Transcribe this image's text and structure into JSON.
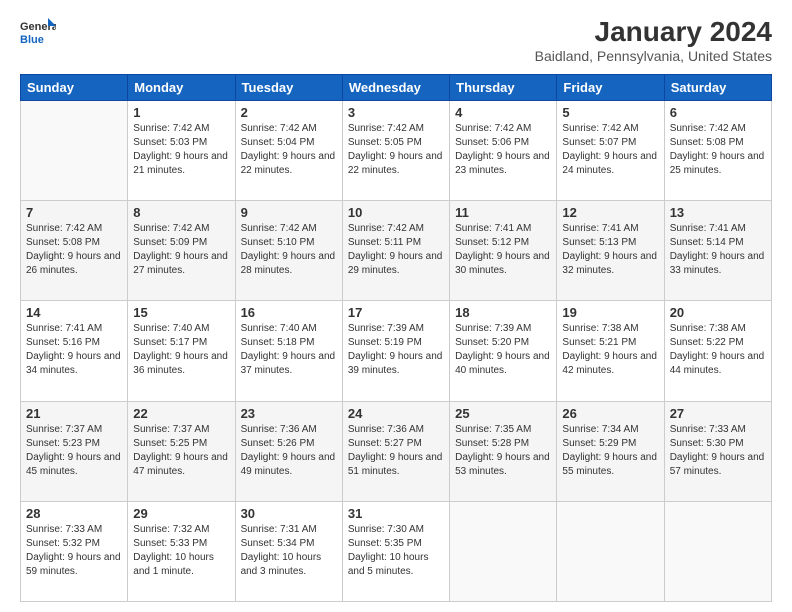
{
  "logo": {
    "general": "General",
    "blue": "Blue"
  },
  "title": {
    "month_year": "January 2024",
    "location": "Baidland, Pennsylvania, United States"
  },
  "days_header": [
    "Sunday",
    "Monday",
    "Tuesday",
    "Wednesday",
    "Thursday",
    "Friday",
    "Saturday"
  ],
  "weeks": [
    [
      {
        "day": "",
        "sunrise": "",
        "sunset": "",
        "daylight": ""
      },
      {
        "day": "1",
        "sunrise": "Sunrise: 7:42 AM",
        "sunset": "Sunset: 5:03 PM",
        "daylight": "Daylight: 9 hours and 21 minutes."
      },
      {
        "day": "2",
        "sunrise": "Sunrise: 7:42 AM",
        "sunset": "Sunset: 5:04 PM",
        "daylight": "Daylight: 9 hours and 22 minutes."
      },
      {
        "day": "3",
        "sunrise": "Sunrise: 7:42 AM",
        "sunset": "Sunset: 5:05 PM",
        "daylight": "Daylight: 9 hours and 22 minutes."
      },
      {
        "day": "4",
        "sunrise": "Sunrise: 7:42 AM",
        "sunset": "Sunset: 5:06 PM",
        "daylight": "Daylight: 9 hours and 23 minutes."
      },
      {
        "day": "5",
        "sunrise": "Sunrise: 7:42 AM",
        "sunset": "Sunset: 5:07 PM",
        "daylight": "Daylight: 9 hours and 24 minutes."
      },
      {
        "day": "6",
        "sunrise": "Sunrise: 7:42 AM",
        "sunset": "Sunset: 5:08 PM",
        "daylight": "Daylight: 9 hours and 25 minutes."
      }
    ],
    [
      {
        "day": "7",
        "sunrise": "Sunrise: 7:42 AM",
        "sunset": "Sunset: 5:08 PM",
        "daylight": "Daylight: 9 hours and 26 minutes."
      },
      {
        "day": "8",
        "sunrise": "Sunrise: 7:42 AM",
        "sunset": "Sunset: 5:09 PM",
        "daylight": "Daylight: 9 hours and 27 minutes."
      },
      {
        "day": "9",
        "sunrise": "Sunrise: 7:42 AM",
        "sunset": "Sunset: 5:10 PM",
        "daylight": "Daylight: 9 hours and 28 minutes."
      },
      {
        "day": "10",
        "sunrise": "Sunrise: 7:42 AM",
        "sunset": "Sunset: 5:11 PM",
        "daylight": "Daylight: 9 hours and 29 minutes."
      },
      {
        "day": "11",
        "sunrise": "Sunrise: 7:41 AM",
        "sunset": "Sunset: 5:12 PM",
        "daylight": "Daylight: 9 hours and 30 minutes."
      },
      {
        "day": "12",
        "sunrise": "Sunrise: 7:41 AM",
        "sunset": "Sunset: 5:13 PM",
        "daylight": "Daylight: 9 hours and 32 minutes."
      },
      {
        "day": "13",
        "sunrise": "Sunrise: 7:41 AM",
        "sunset": "Sunset: 5:14 PM",
        "daylight": "Daylight: 9 hours and 33 minutes."
      }
    ],
    [
      {
        "day": "14",
        "sunrise": "Sunrise: 7:41 AM",
        "sunset": "Sunset: 5:16 PM",
        "daylight": "Daylight: 9 hours and 34 minutes."
      },
      {
        "day": "15",
        "sunrise": "Sunrise: 7:40 AM",
        "sunset": "Sunset: 5:17 PM",
        "daylight": "Daylight: 9 hours and 36 minutes."
      },
      {
        "day": "16",
        "sunrise": "Sunrise: 7:40 AM",
        "sunset": "Sunset: 5:18 PM",
        "daylight": "Daylight: 9 hours and 37 minutes."
      },
      {
        "day": "17",
        "sunrise": "Sunrise: 7:39 AM",
        "sunset": "Sunset: 5:19 PM",
        "daylight": "Daylight: 9 hours and 39 minutes."
      },
      {
        "day": "18",
        "sunrise": "Sunrise: 7:39 AM",
        "sunset": "Sunset: 5:20 PM",
        "daylight": "Daylight: 9 hours and 40 minutes."
      },
      {
        "day": "19",
        "sunrise": "Sunrise: 7:38 AM",
        "sunset": "Sunset: 5:21 PM",
        "daylight": "Daylight: 9 hours and 42 minutes."
      },
      {
        "day": "20",
        "sunrise": "Sunrise: 7:38 AM",
        "sunset": "Sunset: 5:22 PM",
        "daylight": "Daylight: 9 hours and 44 minutes."
      }
    ],
    [
      {
        "day": "21",
        "sunrise": "Sunrise: 7:37 AM",
        "sunset": "Sunset: 5:23 PM",
        "daylight": "Daylight: 9 hours and 45 minutes."
      },
      {
        "day": "22",
        "sunrise": "Sunrise: 7:37 AM",
        "sunset": "Sunset: 5:25 PM",
        "daylight": "Daylight: 9 hours and 47 minutes."
      },
      {
        "day": "23",
        "sunrise": "Sunrise: 7:36 AM",
        "sunset": "Sunset: 5:26 PM",
        "daylight": "Daylight: 9 hours and 49 minutes."
      },
      {
        "day": "24",
        "sunrise": "Sunrise: 7:36 AM",
        "sunset": "Sunset: 5:27 PM",
        "daylight": "Daylight: 9 hours and 51 minutes."
      },
      {
        "day": "25",
        "sunrise": "Sunrise: 7:35 AM",
        "sunset": "Sunset: 5:28 PM",
        "daylight": "Daylight: 9 hours and 53 minutes."
      },
      {
        "day": "26",
        "sunrise": "Sunrise: 7:34 AM",
        "sunset": "Sunset: 5:29 PM",
        "daylight": "Daylight: 9 hours and 55 minutes."
      },
      {
        "day": "27",
        "sunrise": "Sunrise: 7:33 AM",
        "sunset": "Sunset: 5:30 PM",
        "daylight": "Daylight: 9 hours and 57 minutes."
      }
    ],
    [
      {
        "day": "28",
        "sunrise": "Sunrise: 7:33 AM",
        "sunset": "Sunset: 5:32 PM",
        "daylight": "Daylight: 9 hours and 59 minutes."
      },
      {
        "day": "29",
        "sunrise": "Sunrise: 7:32 AM",
        "sunset": "Sunset: 5:33 PM",
        "daylight": "Daylight: 10 hours and 1 minute."
      },
      {
        "day": "30",
        "sunrise": "Sunrise: 7:31 AM",
        "sunset": "Sunset: 5:34 PM",
        "daylight": "Daylight: 10 hours and 3 minutes."
      },
      {
        "day": "31",
        "sunrise": "Sunrise: 7:30 AM",
        "sunset": "Sunset: 5:35 PM",
        "daylight": "Daylight: 10 hours and 5 minutes."
      },
      {
        "day": "",
        "sunrise": "",
        "sunset": "",
        "daylight": ""
      },
      {
        "day": "",
        "sunrise": "",
        "sunset": "",
        "daylight": ""
      },
      {
        "day": "",
        "sunrise": "",
        "sunset": "",
        "daylight": ""
      }
    ]
  ]
}
